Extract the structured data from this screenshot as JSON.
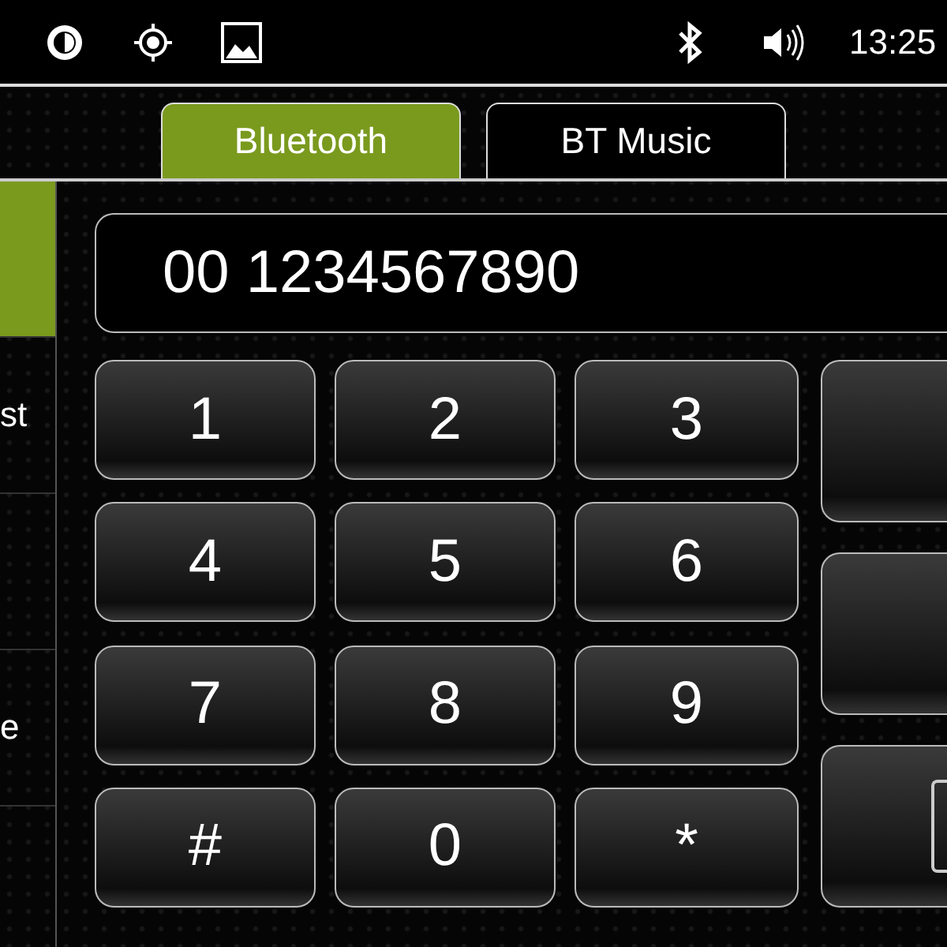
{
  "status_bar": {
    "time": "13:25"
  },
  "tabs": [
    {
      "label": "Bluetooth",
      "selected": true
    },
    {
      "label": "BT Music",
      "selected": false
    }
  ],
  "sidebar": {
    "items": [
      {
        "selected": true
      },
      {
        "label": "st",
        "selected": false
      },
      {
        "selected": false
      },
      {
        "label": "e",
        "selected": false
      }
    ]
  },
  "display": {
    "value": "00 1234567890"
  },
  "keypad": [
    "1",
    "2",
    "3",
    "4",
    "5",
    "6",
    "7",
    "8",
    "9",
    "#",
    "0",
    "*"
  ],
  "side_buttons": [
    {
      "kind": "blank"
    },
    {
      "kind": "blank"
    },
    {
      "kind": "icon"
    }
  ]
}
